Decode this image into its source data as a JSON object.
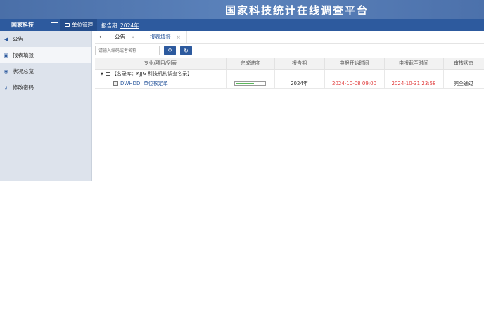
{
  "banner": {
    "title": "国家科技统计在线调查平台"
  },
  "navbar": {
    "brand": "国家科技",
    "module_tab": "单位管理",
    "period_label": "报告期:",
    "period_value": "2024年"
  },
  "sidebar": {
    "items": [
      {
        "label": "公告",
        "icon": "megaphone-icon",
        "active": false
      },
      {
        "label": "报表填报",
        "icon": "form-icon",
        "active": true
      },
      {
        "label": "状况总览",
        "icon": "eye-icon",
        "active": false
      },
      {
        "label": "修改密码",
        "icon": "key-icon",
        "active": false
      }
    ]
  },
  "tabs": [
    {
      "label": "公告",
      "active": false
    },
    {
      "label": "报表填报",
      "active": true
    }
  ],
  "search": {
    "placeholder": "请输入编码或者名称"
  },
  "table": {
    "headers": [
      "专业/项目/列表",
      "完成进度",
      "报告期",
      "申报开始时间",
      "申报截至时间",
      "审核状态"
    ],
    "group_row": {
      "label": "【名录库：KJJG 科技机构调查名录】"
    },
    "rows": [
      {
        "code": "DWHDD",
        "name": "单位核定单",
        "progress": 0.65,
        "period": "2024年",
        "start": "2024-10-08 09:00",
        "end": "2024-10-31 23:58",
        "status": "完全通过"
      }
    ]
  },
  "colors": {
    "accent": "#2d5a9e",
    "banner": "#4a6fa8",
    "date_red": "#e03a3a",
    "progress": "#5cb85c"
  }
}
